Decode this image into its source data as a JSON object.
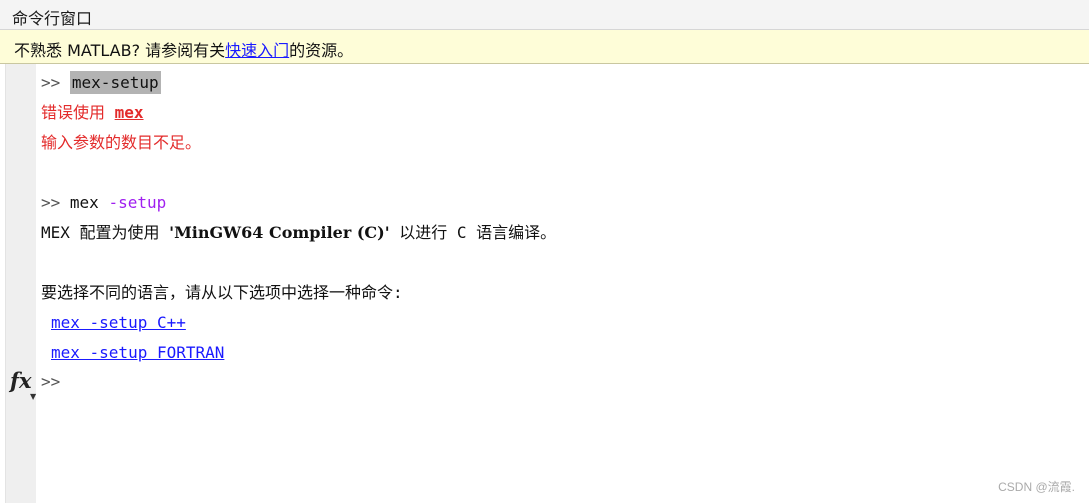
{
  "window": {
    "title": "命令行窗口"
  },
  "infobar": {
    "prefix": "不熟悉 MATLAB? 请参阅有关",
    "link_text": "快速入门",
    "suffix": "的资源。"
  },
  "console": {
    "prompt": ">>",
    "line1_command": "mex-setup",
    "line2_error_prefix": "错误使用 ",
    "line2_error_fn": "mex",
    "line3_error_msg": "输入参数的数目不足。",
    "line5_cmd_name": "mex",
    "line5_cmd_arg": "-setup",
    "line6_prefix": "MEX 配置为使用 ",
    "line6_compiler": "'MinGW64 Compiler (C)'",
    "line6_suffix": " 以进行 C 语言编译。",
    "line8_text": "要选择不同的语言，请从以下选项中选择一种命令:",
    "option_cpp": "mex -setup C++",
    "option_fortran": "mex -setup FORTRAN"
  },
  "fx_label": "fx",
  "watermark": "CSDN @流霞."
}
